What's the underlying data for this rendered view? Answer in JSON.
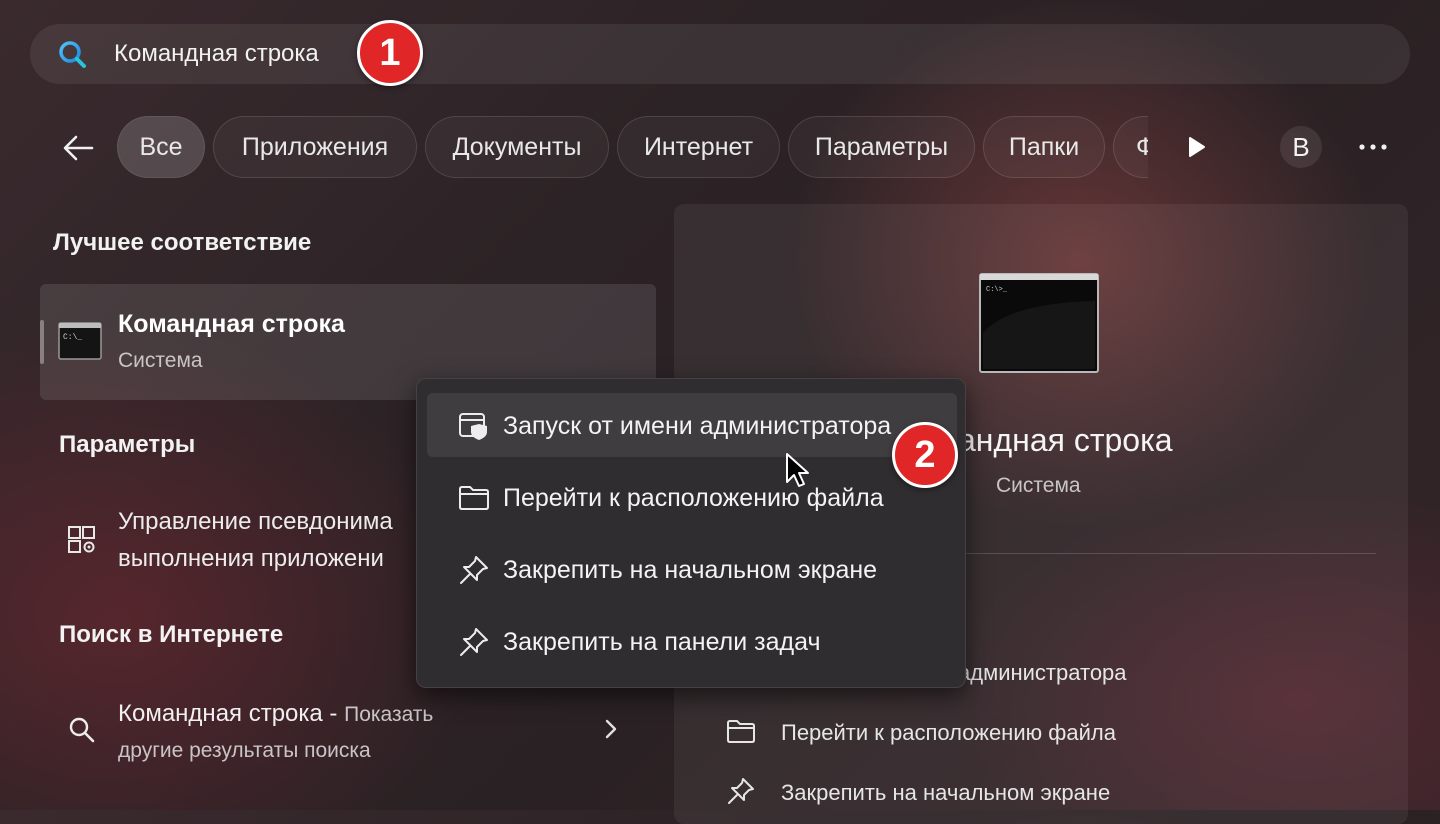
{
  "search": {
    "query": "Командная строка"
  },
  "callouts": {
    "first": "1",
    "second": "2"
  },
  "filters": {
    "back_icon": "back-arrow-icon",
    "chips": [
      "Все",
      "Приложения",
      "Документы",
      "Интернет",
      "Параметры",
      "Папки",
      "Ф"
    ],
    "more_chips_icon": "play-arrow-icon",
    "avatar_letter": "В",
    "overflow_icon": "more-dots-icon"
  },
  "best_match": {
    "section_title": "Лучшее соответствие",
    "app_name": "Командная строка",
    "app_type": "Система"
  },
  "settings": {
    "section_title": "Параметры",
    "item_line1": "Управление псевдонима",
    "item_line2": "выполнения приложени"
  },
  "web_search": {
    "section_title": "Поиск в Интернете",
    "query": "Командная строка",
    "separator": " - ",
    "suffix": "Показать",
    "line2": "другие результаты поиска"
  },
  "context_menu": {
    "items": [
      {
        "label": "Запуск от имени администратора",
        "icon": "shield-window-icon"
      },
      {
        "label": "Перейти к расположению файла",
        "icon": "folder-icon"
      },
      {
        "label": "Закрепить на начальном экране",
        "icon": "pin-icon"
      },
      {
        "label": "Закрепить на панели задач",
        "icon": "pin-icon"
      }
    ]
  },
  "preview": {
    "title_partial": "андная строка",
    "subtitle": "Система",
    "actions": [
      {
        "label": "администратора",
        "icon": ""
      },
      {
        "label": "Перейти к расположению файла",
        "icon": "folder-icon"
      },
      {
        "label": "Закрепить на начальном экране",
        "icon": "pin-icon"
      }
    ]
  }
}
